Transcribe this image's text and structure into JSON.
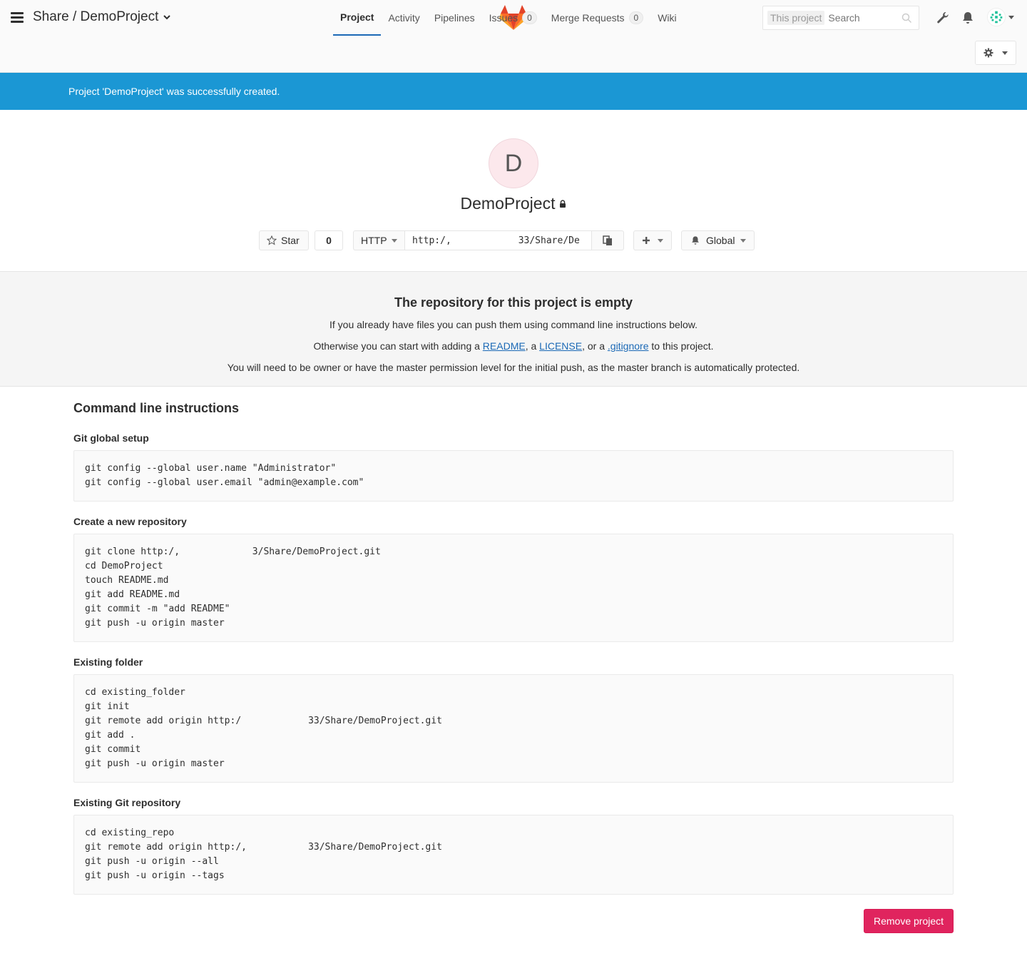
{
  "header": {
    "title": "Share / DemoProject",
    "search_scope": "This project",
    "search_placeholder": "Search"
  },
  "nav": {
    "tabs": [
      {
        "label": "Project",
        "active": true
      },
      {
        "label": "Activity"
      },
      {
        "label": "Pipelines"
      },
      {
        "label": "Issues",
        "badge": "0"
      },
      {
        "label": "Merge Requests",
        "badge": "0"
      },
      {
        "label": "Wiki"
      }
    ]
  },
  "flash": {
    "message": "Project 'DemoProject' was successfully created."
  },
  "project": {
    "avatar_letter": "D",
    "name": "DemoProject",
    "star_label": "Star",
    "star_count": "0",
    "protocol": "HTTP",
    "clone_url": "http:/,            33/Share/De",
    "notification_label": "Global"
  },
  "empty_repo": {
    "title": "The repository for this project is empty",
    "line1": "If you already have files you can push them using command line instructions below.",
    "line2_prefix": "Otherwise you can start with adding a ",
    "readme_link": "README",
    "sep1": ", a ",
    "license_link": "LICENSE",
    "sep2": ", or a ",
    "gitignore_link": ".gitignore",
    "line2_suffix": " to this project.",
    "line3": "You will need to be owner or have the master permission level for the initial push, as the master branch is automatically protected."
  },
  "cli": {
    "title": "Command line instructions",
    "sections": [
      {
        "title": "Git global setup",
        "code": "git config --global user.name \"Administrator\"\ngit config --global user.email \"admin@example.com\""
      },
      {
        "title": "Create a new repository",
        "code": "git clone http:/,             3/Share/DemoProject.git\ncd DemoProject\ntouch README.md\ngit add README.md\ngit commit -m \"add README\"\ngit push -u origin master"
      },
      {
        "title": "Existing folder",
        "code": "cd existing_folder\ngit init\ngit remote add origin http:/            33/Share/DemoProject.git\ngit add .\ngit commit\ngit push -u origin master"
      },
      {
        "title": "Existing Git repository",
        "code": "cd existing_repo\ngit remote add origin http:/,           33/Share/DemoProject.git\ngit push -u origin --all\ngit push -u origin --tags"
      }
    ]
  },
  "remove_button": "Remove project",
  "colors": {
    "flash_bg": "#1b97d4",
    "link": "#1b69b6",
    "danger": "#e0245e",
    "active_tab_border": "#1b69b6"
  },
  "icons": [
    "menu-icon",
    "chevron-down-icon",
    "gitlab-logo",
    "search-icon",
    "wrench-icon",
    "bell-icon",
    "user-avatar",
    "gear-icon",
    "star-icon",
    "copy-icon",
    "plus-icon",
    "lock-icon"
  ]
}
